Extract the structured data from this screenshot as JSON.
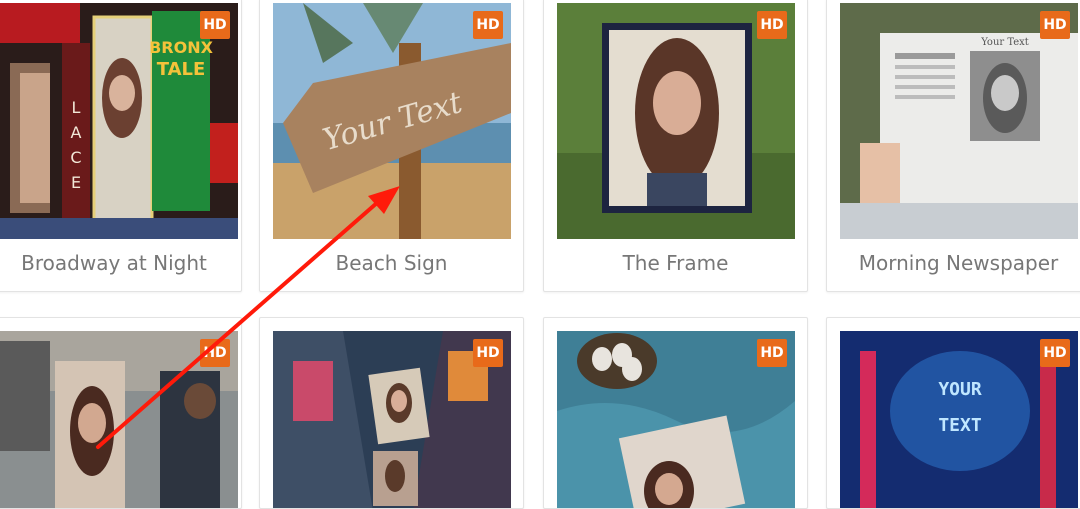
{
  "gallery": {
    "hd_badge": "HD",
    "items": [
      {
        "caption": "Broadway at Night",
        "thumb": "broadway-billboard-photo"
      },
      {
        "caption": "Beach Sign",
        "thumb": "beach-wooden-sign-photo",
        "sign_text": "Your Text"
      },
      {
        "caption": "The Frame",
        "thumb": "woman-holding-frame-photo"
      },
      {
        "caption": "Morning Newspaper",
        "thumb": "newspaper-photo",
        "paper_text": "Your Text"
      },
      {
        "caption": "",
        "thumb": "street-painter-photo"
      },
      {
        "caption": "",
        "thumb": "city-billboards-photo"
      },
      {
        "caption": "",
        "thumb": "blanket-eggs-photo"
      },
      {
        "caption": "",
        "thumb": "neon-sign-photo",
        "neon_text": [
          "YOUR",
          "TEXT"
        ]
      }
    ],
    "billboard_letters": [
      "L",
      "A",
      "C",
      "E"
    ],
    "billboard_sign": [
      "BRONX",
      "TALE"
    ]
  },
  "annotation": {
    "type": "arrow",
    "color": "#ff1a0a"
  }
}
